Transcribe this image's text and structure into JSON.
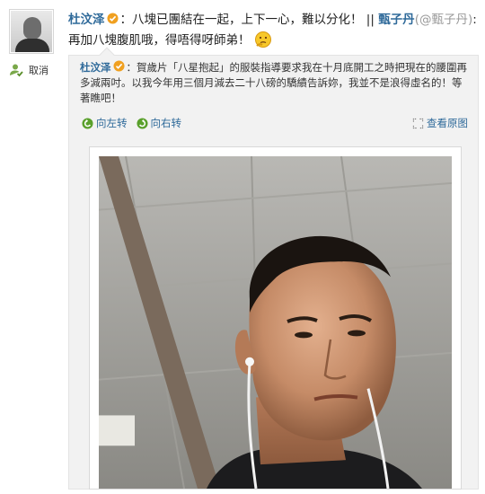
{
  "post": {
    "author": "杜汶泽",
    "text": "：八塊已團結在一起，上下一心，難以分化！",
    "separator": " ||",
    "mention_name": "甄子丹",
    "mention_handle": "(@甄子丹)",
    "text2": ": 再加八塊腹肌哦，得唔得呀師弟！"
  },
  "sidebar": {
    "unfollow_label": "取消"
  },
  "repost": {
    "author": "杜汶泽",
    "text": "：賀歲片「八星抱起」的服裝指導要求我在十月底開工之時把現在的腰圍再多減兩吋。以我今年用三個月減去二十八磅的驕績告訴妳，我並不是浪得虛名的！等著瞧吧！"
  },
  "toolbar": {
    "rotate_left_label": "向左转",
    "rotate_right_label": "向右转",
    "view_original_label": "查看原图"
  },
  "icons": {
    "avatar": "avatar-photo",
    "unfollow": "user-check-icon",
    "verified": "verified-badge-icon",
    "emoji": "thinking-emoji-icon",
    "rotate_left": "rotate-left-icon",
    "rotate_right": "rotate-right-icon",
    "view_original": "expand-icon"
  },
  "colors": {
    "link": "#2f6a9a",
    "repost_bg": "#f2f2f2",
    "badge": "#f0a020"
  }
}
